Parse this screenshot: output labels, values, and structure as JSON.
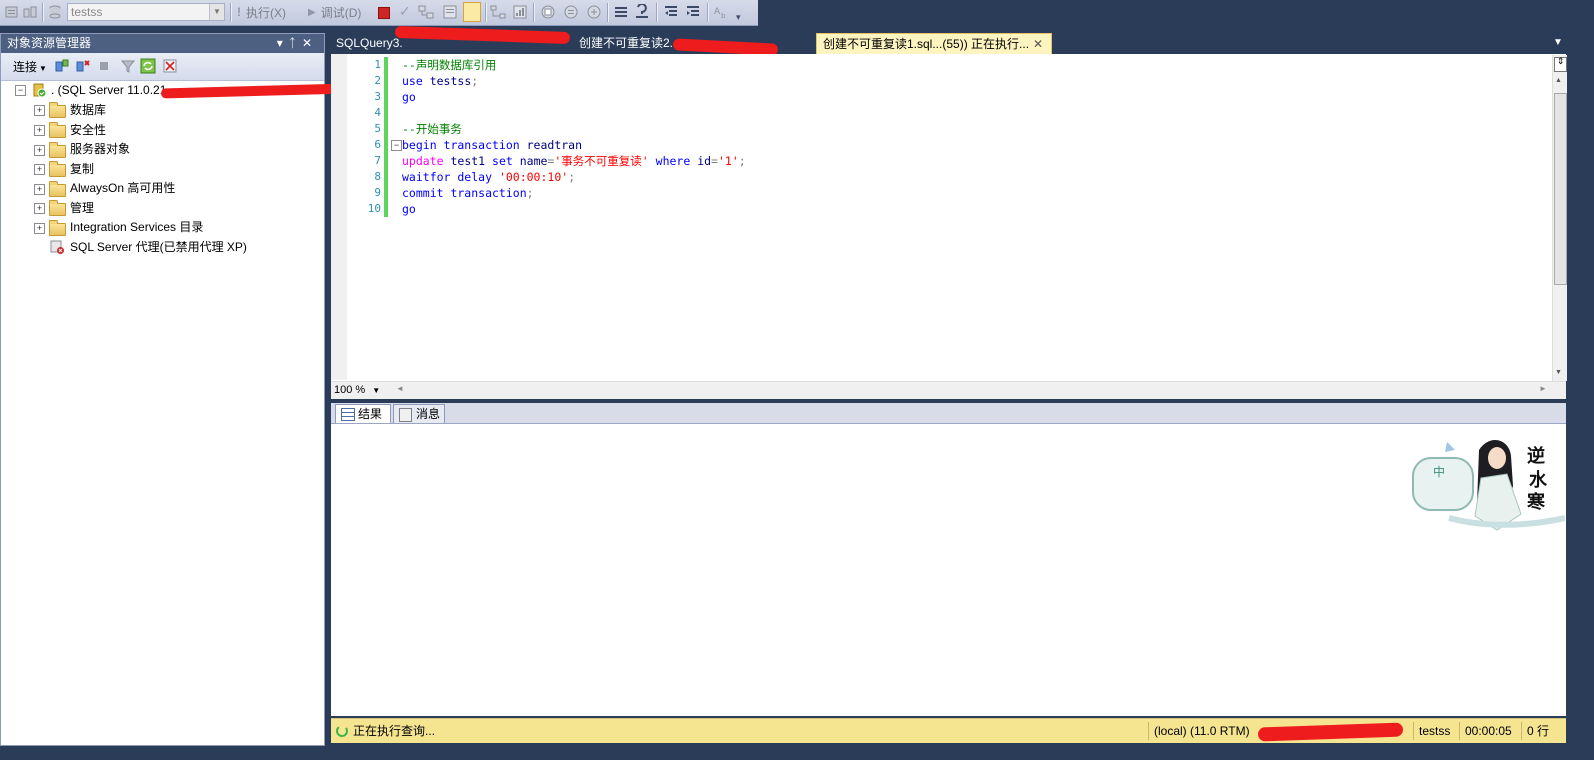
{
  "toolbar": {
    "database": "testss",
    "execute_label": "执行(X)",
    "debug_label": "调试(D)"
  },
  "object_explorer": {
    "title": "对象资源管理器",
    "connect_label": "连接",
    "server_label": ". (SQL Server 11.0.21",
    "items": [
      {
        "label": "数据库"
      },
      {
        "label": "安全性"
      },
      {
        "label": "服务器对象"
      },
      {
        "label": "复制"
      },
      {
        "label": "AlwaysOn 高可用性"
      },
      {
        "label": "管理"
      },
      {
        "label": "Integration Services 目录"
      }
    ],
    "agent_label": "SQL Server 代理(已禁用代理 XP)"
  },
  "tabs": [
    {
      "label": "SQLQuery3."
    },
    {
      "label": "创建不可重复读2."
    },
    {
      "label": "创建不可重复读1.sql...(55)) 正在执行..."
    }
  ],
  "editor": {
    "line_numbers": [
      "1",
      "2",
      "3",
      "4",
      "5",
      "6",
      "7",
      "8",
      "9",
      "10"
    ],
    "zoom": "100 %",
    "lines": {
      "l1": "--声明数据库引用",
      "l2a": "use",
      "l2b": " testss",
      "l2c": ";",
      "l3": "go",
      "l5": "--开始事务",
      "l6a": "begin transaction",
      "l6b": " readtran",
      "l7a": "update",
      "l7b": " test1 ",
      "l7c": "set",
      "l7d": " name",
      "l7e": "=",
      "l7f": "'事务不可重复读'",
      "l7g": " where ",
      "l7h": "id",
      "l7i": "=",
      "l7j": "'1'",
      "l7k": ";",
      "l8a": "waitfor delay",
      "l8b": " '00:00:10'",
      "l8c": ";",
      "l9a": "commit transaction",
      "l9b": ";",
      "l10": "go"
    }
  },
  "results_tabs": {
    "results": "结果",
    "messages": "消息"
  },
  "status": {
    "executing": "正在执行查询...",
    "server": "(local) (11.0 RTM)",
    "database": "testss",
    "elapsed": "00:00:05",
    "rows": "0 行"
  },
  "colors": {
    "comment": "#008000",
    "keyword": "#0000ff",
    "string": "#ff0000",
    "function": "#ff00ff",
    "status_bar": "#f5e591",
    "frame": "#2b3c59"
  }
}
